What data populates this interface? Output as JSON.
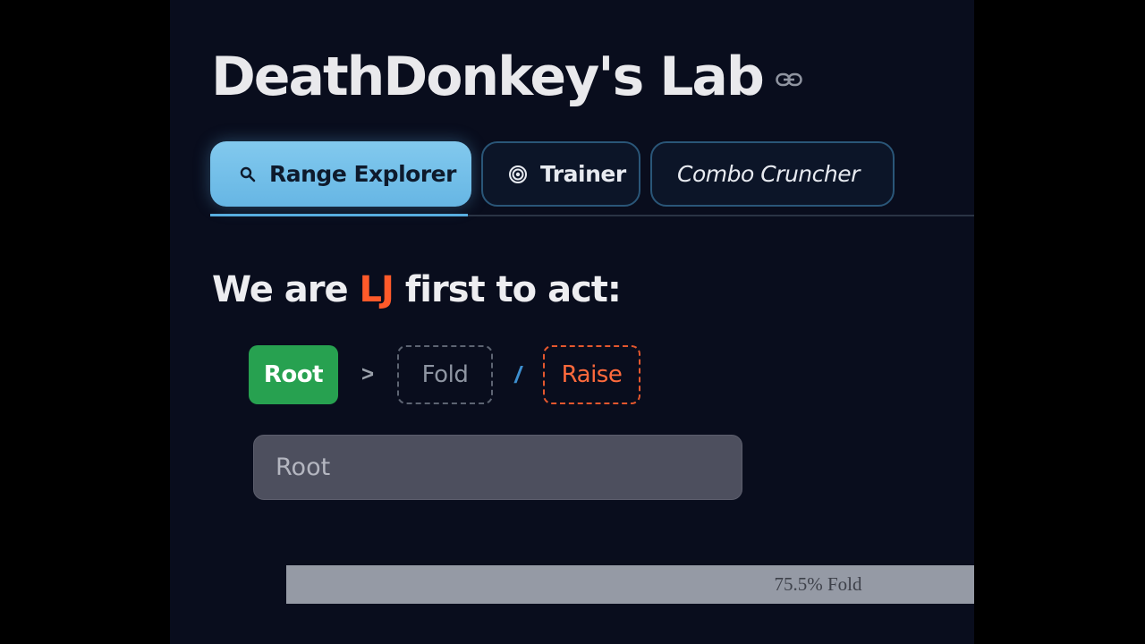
{
  "app": {
    "title": "DeathDonkey's Lab",
    "link_icon": "link-icon"
  },
  "tabs": [
    {
      "label": "Range Explorer",
      "icon": "search-icon",
      "active": true
    },
    {
      "label": "Trainer",
      "icon": "target-icon",
      "active": false
    },
    {
      "label": "Combo Cruncher",
      "icon": "",
      "active": false
    }
  ],
  "prompt": {
    "prefix": "We are",
    "position": "LJ",
    "suffix": "first to act:"
  },
  "breadcrumb": {
    "root": "Root",
    "separator": ">",
    "options": [
      "Fold",
      "Raise"
    ],
    "option_separator": "/"
  },
  "node_input": {
    "value": "Root"
  },
  "frequency": {
    "label": "75.5% Fold",
    "fold_fraction": 0.755
  },
  "colors": {
    "background": "#090d1d",
    "accent_tab": "#74bfe9",
    "position_highlight": "#ff5a2a",
    "root_chip": "#27a150",
    "raise": "#ff6a3c",
    "fold_bar": "#959aa5"
  }
}
